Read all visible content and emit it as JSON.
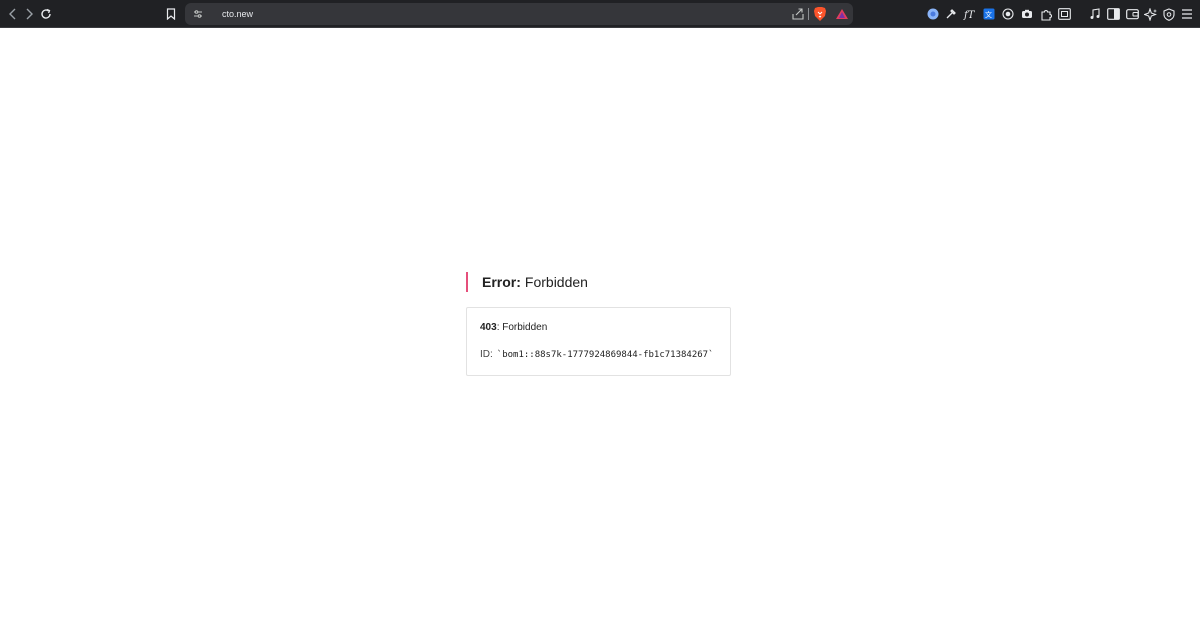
{
  "browser": {
    "url": "cto.new",
    "extensions": [
      "ext-circle-icon",
      "color-picker-icon",
      "font-icon",
      "translate-icon",
      "record-icon",
      "camera-icon",
      "puzzle-icon",
      "screenshot-icon",
      "music-icon",
      "sidebar-icon",
      "wallet-icon",
      "leo-ai-icon",
      "vpn-shield-icon",
      "menu-icon"
    ]
  },
  "error": {
    "label": "Error:",
    "message": "Forbidden",
    "code": "403",
    "separator": ": Forbidden",
    "id_label": "ID:",
    "id_value": "`bom1::88s7k-1777924869844-fb1c71384267`"
  },
  "colors": {
    "accent": "#e54f7b",
    "toolbar": "#202124",
    "omnibox": "#35363a"
  }
}
